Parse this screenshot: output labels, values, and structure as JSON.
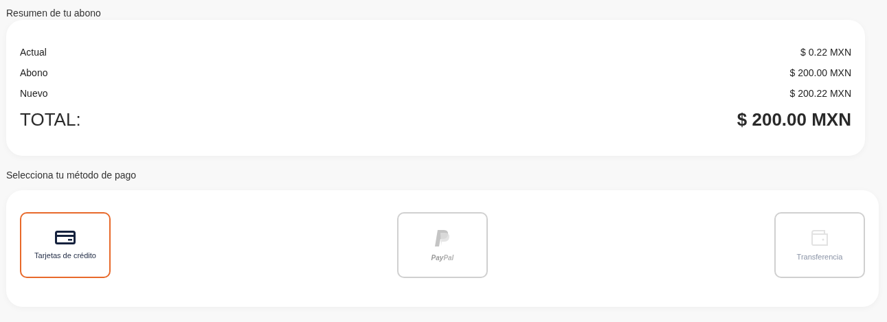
{
  "summary": {
    "title": "Resumen de tu abono",
    "rows": [
      {
        "label": "Actual",
        "value": "$ 0.22 MXN"
      },
      {
        "label": "Abono",
        "value": "$ 200.00 MXN"
      },
      {
        "label": "Nuevo",
        "value": "$ 200.22 MXN"
      }
    ],
    "total": {
      "label": "TOTAL:",
      "value": "$ 200.00 MXN"
    }
  },
  "payment": {
    "title": "Selecciona tu método de pago",
    "methods": [
      {
        "kind": "card",
        "label": "Tarjetas de crédito",
        "selected": true
      },
      {
        "kind": "paypal",
        "logo_text": [
          "Pay",
          "Pal"
        ],
        "selected": false
      },
      {
        "kind": "wallet",
        "label": "Transferencia",
        "selected": false
      }
    ]
  }
}
